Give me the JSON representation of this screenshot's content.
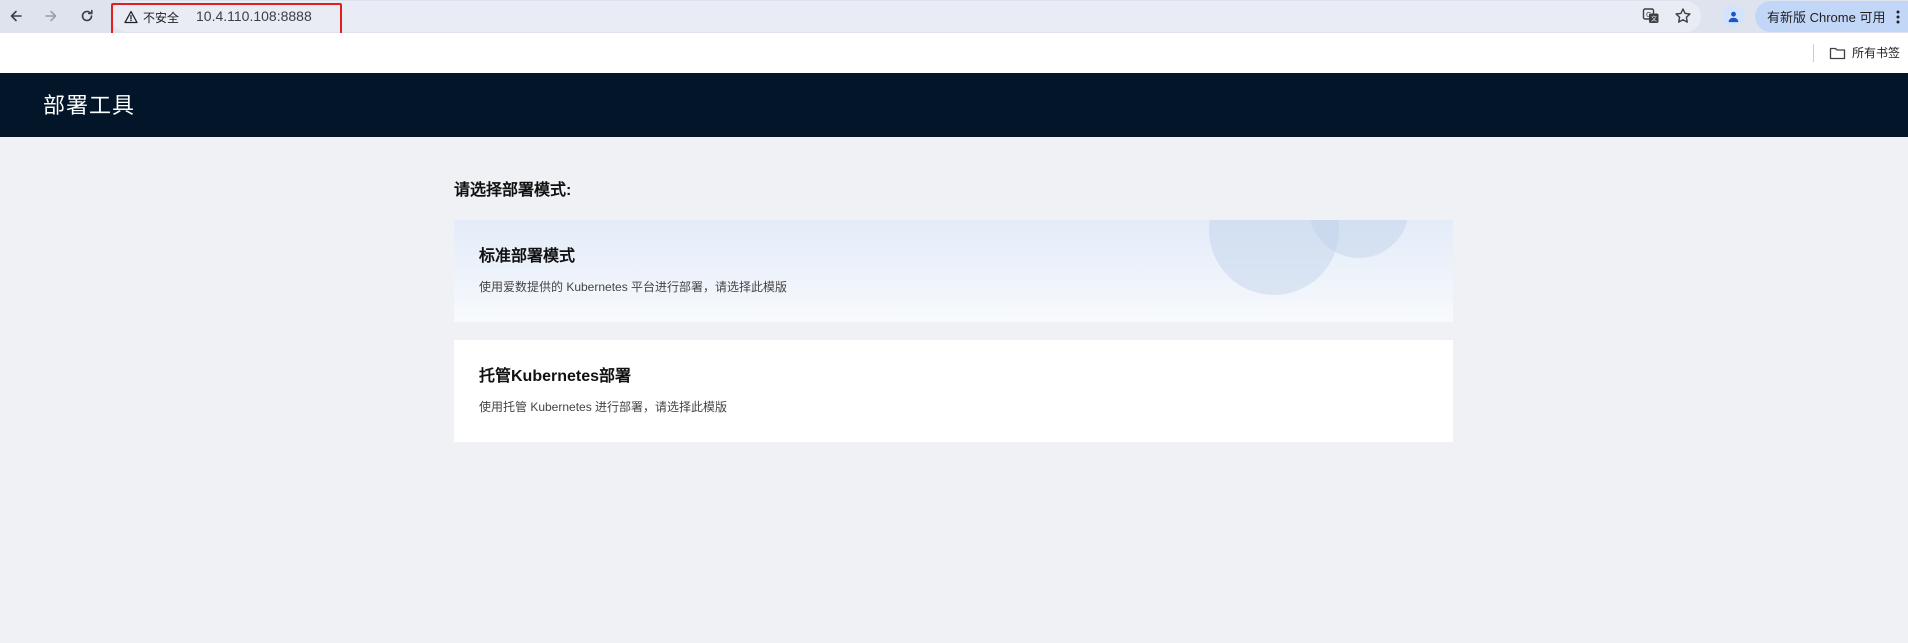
{
  "browser": {
    "security_label": "不安全",
    "url": "10.4.110.108:8888",
    "update_label": "有新版 Chrome 可用",
    "bookmarks_folder_label": "所有书签"
  },
  "app": {
    "title": "部署工具"
  },
  "main": {
    "prompt": "请选择部署模式:",
    "options": [
      {
        "title": "标准部署模式",
        "description": "使用爱数提供的 Kubernetes 平台进行部署，请选择此模版"
      },
      {
        "title": "托管Kubernetes部署",
        "description": "使用托管 Kubernetes 进行部署，请选择此模版"
      }
    ]
  },
  "colors": {
    "header_bg": "#021529",
    "page_bg": "#f0f1f5",
    "highlight_border": "#e02020"
  }
}
